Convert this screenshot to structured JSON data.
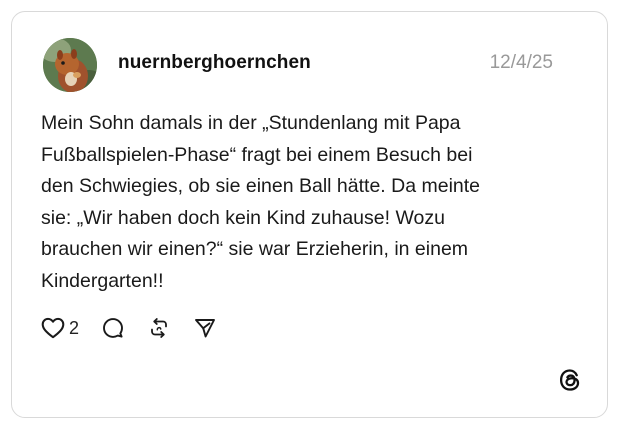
{
  "post": {
    "username": "nuernberghoernchen",
    "timestamp": "12/4/25",
    "text": "Mein Sohn damals in der „Stundenlang mit Papa\nFußballspielen-Phase“ fragt bei einem Besuch bei\nden Schwiegies, ob sie einen Ball hätte. Da meinte\nsie: „Wir haben doch kein Kind zuhause! Wozu\nbrauchen wir einen?“ sie war Erzieherin, in einem\nKindergarten!!",
    "avatar_icon": "squirrel-photo-avatar"
  },
  "actions": {
    "like_count": "2",
    "like_icon": "heart-icon",
    "reply_icon": "speech-bubble-icon",
    "repost_icon": "repost-icon",
    "share_icon": "paper-plane-icon"
  },
  "branding": {
    "logo_icon": "threads-logo-icon"
  },
  "colors": {
    "text": "#1a1a1a",
    "muted": "#999999",
    "border": "#d9d9d9",
    "background": "#ffffff"
  }
}
